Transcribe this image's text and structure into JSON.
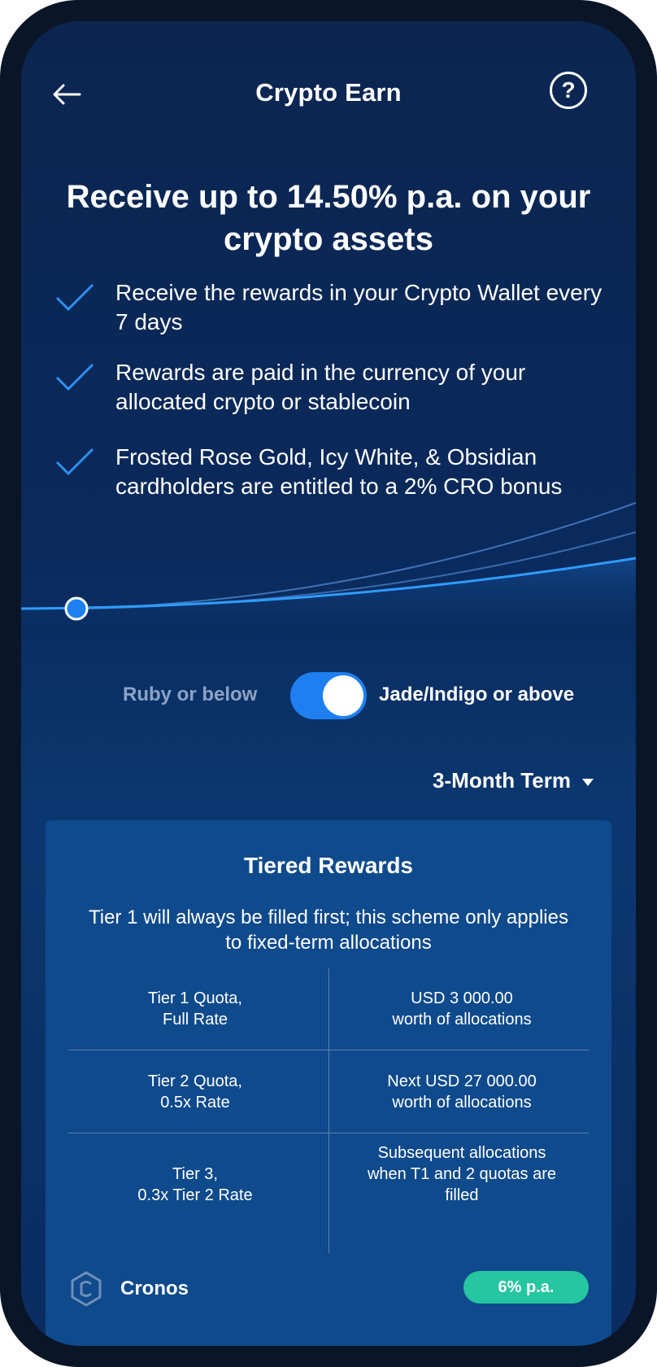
{
  "header": {
    "title": "Crypto Earn",
    "help_label": "?"
  },
  "headline": "Receive up to 14.50% p.a. on your crypto assets",
  "features": [
    {
      "text": "Receive the rewards in your Crypto Wallet every 7 days"
    },
    {
      "text": "Rewards are paid in the currency of your allocated crypto or stablecoin"
    },
    {
      "text": "Frosted Rose Gold, Icy White, & Obsidian cardholders are entitled to a 2% CRO bonus"
    }
  ],
  "tier_toggle": {
    "left_label": "Ruby or below",
    "right_label": "Jade/Indigo or above",
    "selected": "right"
  },
  "term_selector": {
    "label": "3-Month Term"
  },
  "tiered_rewards": {
    "title": "Tiered Rewards",
    "description": "Tier 1 will always be filled first; this scheme only applies to fixed-term allocations",
    "rows": [
      {
        "tier": "Tier 1 Quota,\nFull Rate",
        "amount": "USD 3 000.00\nworth of allocations"
      },
      {
        "tier": "Tier 2 Quota,\n0.5x Rate",
        "amount": "Next USD 27 000.00\nworth of allocations"
      },
      {
        "tier": "Tier 3,\n0.3x Tier 2 Rate",
        "amount": "Subsequent allocations\nwhen T1 and 2 quotas are\nfilled"
      }
    ]
  },
  "coin": {
    "name": "Cronos",
    "rate": "6% p.a.",
    "icon": "cronos-logo-icon"
  },
  "colors": {
    "accent": "#1e7ff0",
    "rate_badge": "#26c6a0",
    "card_bg": "#0f4a8c",
    "muted_text": "#8da3c4"
  }
}
